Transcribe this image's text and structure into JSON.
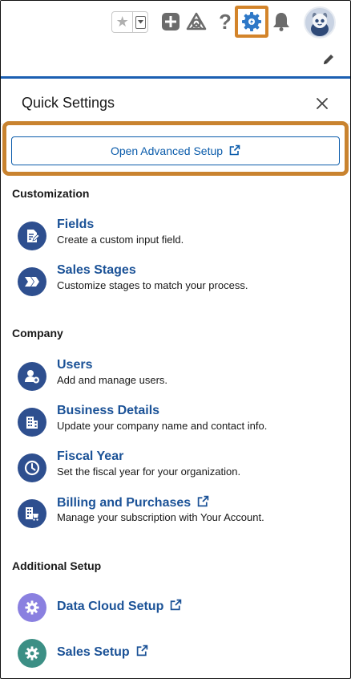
{
  "colors": {
    "accent": "#0b5cab",
    "title_blue": "#1b5297",
    "icon_navy": "#2e4f8f",
    "icon_purple": "#8a80e0",
    "icon_teal": "#3c8f85",
    "highlight_orange": "#d3842a",
    "header_line": "#1b5fb2"
  },
  "header": {
    "icons": [
      "star-icon",
      "chevron-down-icon",
      "plus-icon",
      "trailhead-icon",
      "help-icon",
      "gear-icon",
      "bell-icon",
      "avatar"
    ],
    "help_glyph": "?"
  },
  "panel": {
    "title": "Quick Settings",
    "advanced_setup_label": "Open Advanced Setup"
  },
  "sections": {
    "customization": {
      "title": "Customization",
      "fields_title": "Fields",
      "fields_desc": "Create a custom input field.",
      "stages_title": "Sales Stages",
      "stages_desc": "Customize stages to match your process."
    },
    "company": {
      "title": "Company",
      "users_title": "Users",
      "users_desc": "Add and manage users.",
      "business_title": "Business Details",
      "business_desc": "Update your company name and contact info.",
      "fiscal_title": "Fiscal Year",
      "fiscal_desc": "Set the fiscal year for your organization.",
      "billing_title": "Billing and Purchases",
      "billing_desc": "Manage your subscription with Your Account."
    },
    "additional": {
      "title": "Additional Setup",
      "datacloud_title": "Data Cloud Setup",
      "sales_title": "Sales Setup"
    }
  }
}
